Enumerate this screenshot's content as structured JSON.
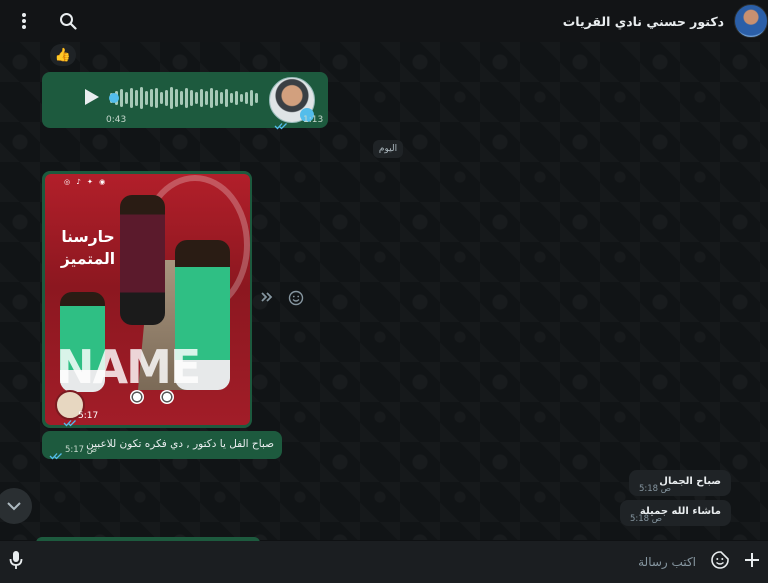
{
  "header": {
    "contact_name": "دكتور حسني نادي القريات",
    "menu_icon": "kebab-menu-icon",
    "search_icon": "search-icon"
  },
  "messages": {
    "reaction_emoji": "👍",
    "voice": {
      "duration": "0:43",
      "time": "1:13"
    },
    "date_separator": "اليوم",
    "image": {
      "poster_title_line1": "حارسنا",
      "poster_title_line2": "المتميز",
      "poster_watermark": "NAME",
      "time": "5:17"
    },
    "out_text": {
      "text": "صباح الفل يا دكتور , دي فكره تكون للاعبين",
      "time": "5:17 ص"
    },
    "incoming": [
      {
        "text": "صباح الجمال",
        "time": "5:18 ص"
      },
      {
        "text": "ماشاء الله جميلة",
        "time": "5:18 ص"
      }
    ]
  },
  "composer": {
    "placeholder": "اكتب رسالة"
  },
  "colors": {
    "outgoing_bubble": "#1d5a3e",
    "incoming_bubble": "#1f2326",
    "read_ticks": "#53bdeb"
  }
}
